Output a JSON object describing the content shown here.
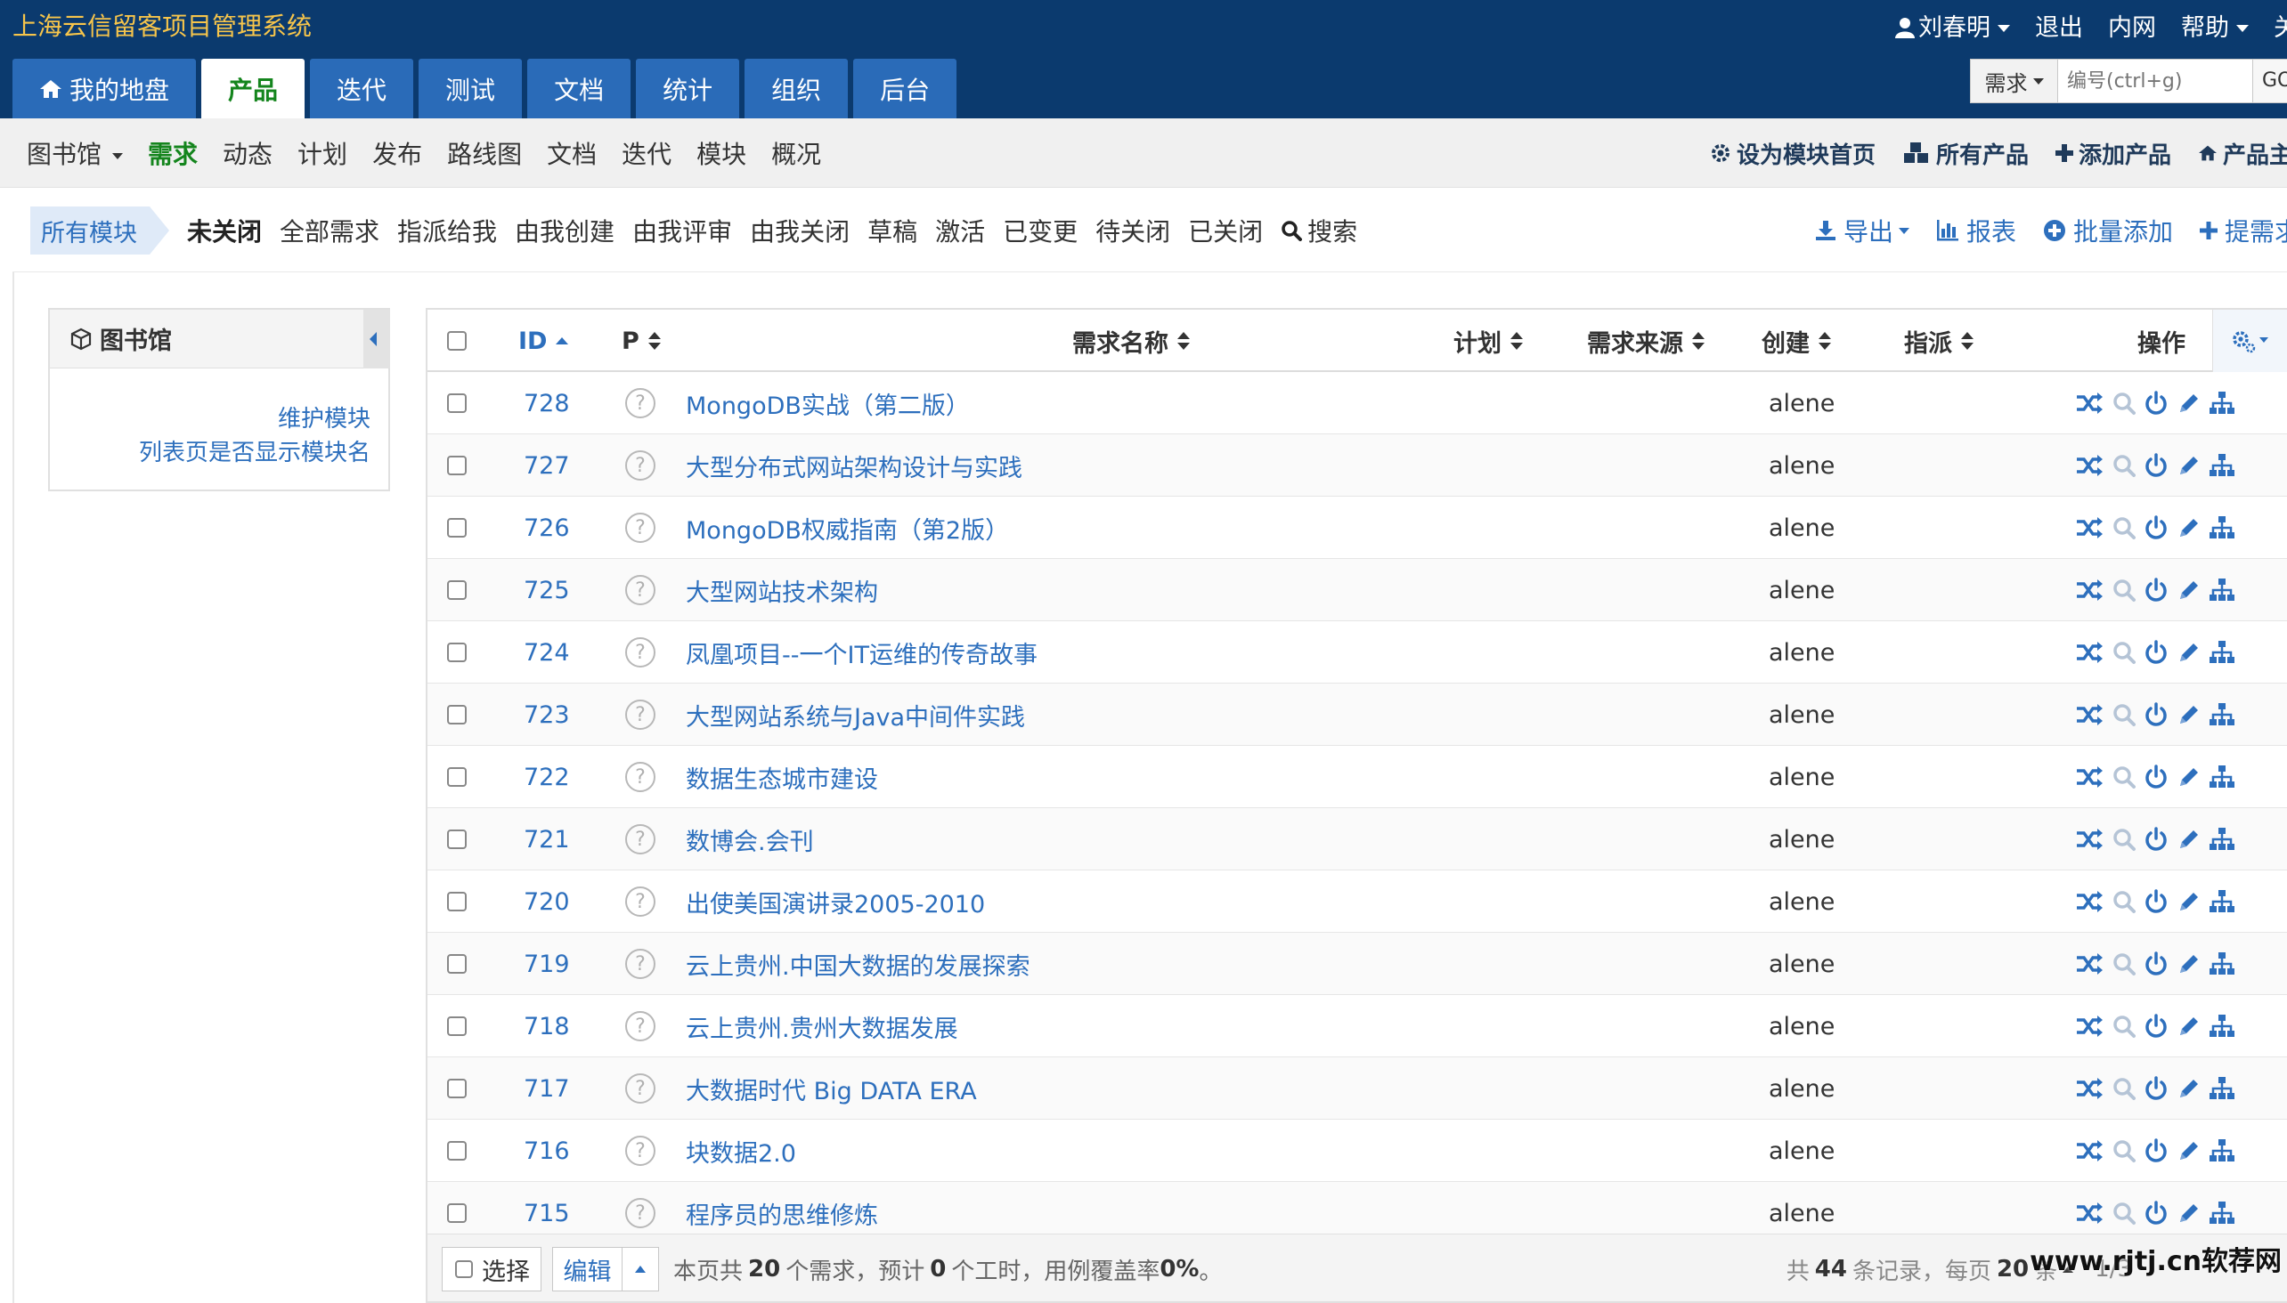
{
  "header": {
    "app_title": "上海云信留客项目管理系统",
    "user_name": "刘春明",
    "logout": "退出",
    "intranet": "内网",
    "help": "帮助",
    "about": "关",
    "search_type": "需求",
    "search_placeholder": "编号(ctrl+g)",
    "search_go": "GO"
  },
  "main_nav": [
    {
      "label": "我的地盘",
      "icon": "home-icon"
    },
    {
      "label": "产品",
      "active": true
    },
    {
      "label": "迭代"
    },
    {
      "label": "测试"
    },
    {
      "label": "文档"
    },
    {
      "label": "统计"
    },
    {
      "label": "组织"
    },
    {
      "label": "后台"
    }
  ],
  "subnav": {
    "product": "图书馆",
    "items": [
      "需求",
      "动态",
      "计划",
      "发布",
      "路线图",
      "文档",
      "迭代",
      "模块",
      "概况"
    ],
    "active_index": 0,
    "right": {
      "set_home": "设为模块首页",
      "all_products": "所有产品",
      "add_product": "添加产品",
      "product_main": "产品主"
    }
  },
  "featurebar": {
    "crumb": "所有模块",
    "filters": [
      "未关闭",
      "全部需求",
      "指派给我",
      "由我创建",
      "由我评审",
      "由我关闭",
      "草稿",
      "激活",
      "已变更",
      "待关闭",
      "已关闭"
    ],
    "search": "搜索",
    "actions": {
      "export": "导出",
      "report": "报表",
      "batch_add": "批量添加",
      "create": "提需求"
    }
  },
  "sidebar": {
    "title": "图书馆",
    "link_maintain": "维护模块",
    "link_show_module": "列表页是否显示模块名"
  },
  "table": {
    "columns": {
      "id": "ID",
      "pri": "P",
      "title": "需求名称",
      "plan": "计划",
      "source": "需求来源",
      "creator": "创建",
      "assigned": "指派",
      "actions": "操作"
    },
    "rows": [
      {
        "id": "728",
        "pri": "?",
        "title": "MongoDB实战（第二版）",
        "creator": "alene"
      },
      {
        "id": "727",
        "pri": "?",
        "title": "大型分布式网站架构设计与实践",
        "creator": "alene"
      },
      {
        "id": "726",
        "pri": "?",
        "title": "MongoDB权威指南（第2版）",
        "creator": "alene"
      },
      {
        "id": "725",
        "pri": "?",
        "title": "大型网站技术架构",
        "creator": "alene"
      },
      {
        "id": "724",
        "pri": "?",
        "title": "凤凰项目--一个IT运维的传奇故事",
        "creator": "alene"
      },
      {
        "id": "723",
        "pri": "?",
        "title": "大型网站系统与Java中间件实践",
        "creator": "alene"
      },
      {
        "id": "722",
        "pri": "?",
        "title": "数据生态城市建设",
        "creator": "alene"
      },
      {
        "id": "721",
        "pri": "?",
        "title": "数博会.会刊",
        "creator": "alene"
      },
      {
        "id": "720",
        "pri": "?",
        "title": "出使美国演讲录2005-2010",
        "creator": "alene"
      },
      {
        "id": "719",
        "pri": "?",
        "title": "云上贵州.中国大数据的发展探索",
        "creator": "alene"
      },
      {
        "id": "718",
        "pri": "?",
        "title": "云上贵州.贵州大数据发展",
        "creator": "alene"
      },
      {
        "id": "717",
        "pri": "?",
        "title": "大数据时代 Big DATA ERA",
        "creator": "alene"
      },
      {
        "id": "716",
        "pri": "?",
        "title": "块数据2.0",
        "creator": "alene"
      },
      {
        "id": "715",
        "pri": "?",
        "title": "程序员的思维修炼",
        "creator": "alene"
      }
    ]
  },
  "footer": {
    "select_label": "选择",
    "edit_label": "编辑",
    "summary_prefix": "本页共",
    "summary_count": "20",
    "summary_mid": "个需求，预计",
    "summary_hours": "0",
    "summary_suffix": "个工时，用例覆盖率",
    "summary_coverage": "0%",
    "summary_end": "。",
    "total_prefix": "共",
    "total_count": "44",
    "total_suffix": "条记录，每页",
    "per_page": "20",
    "per_page_suffix": "条",
    "page": "1/3"
  },
  "watermark": "www.rjtj.cn软荐网",
  "colors": {
    "header_bg": "#0b3a6e",
    "tab_bg": "#2a6bb8",
    "accent_green": "#14851d",
    "link_blue": "#2d6fbd",
    "title_yellow": "#f7c54b"
  }
}
